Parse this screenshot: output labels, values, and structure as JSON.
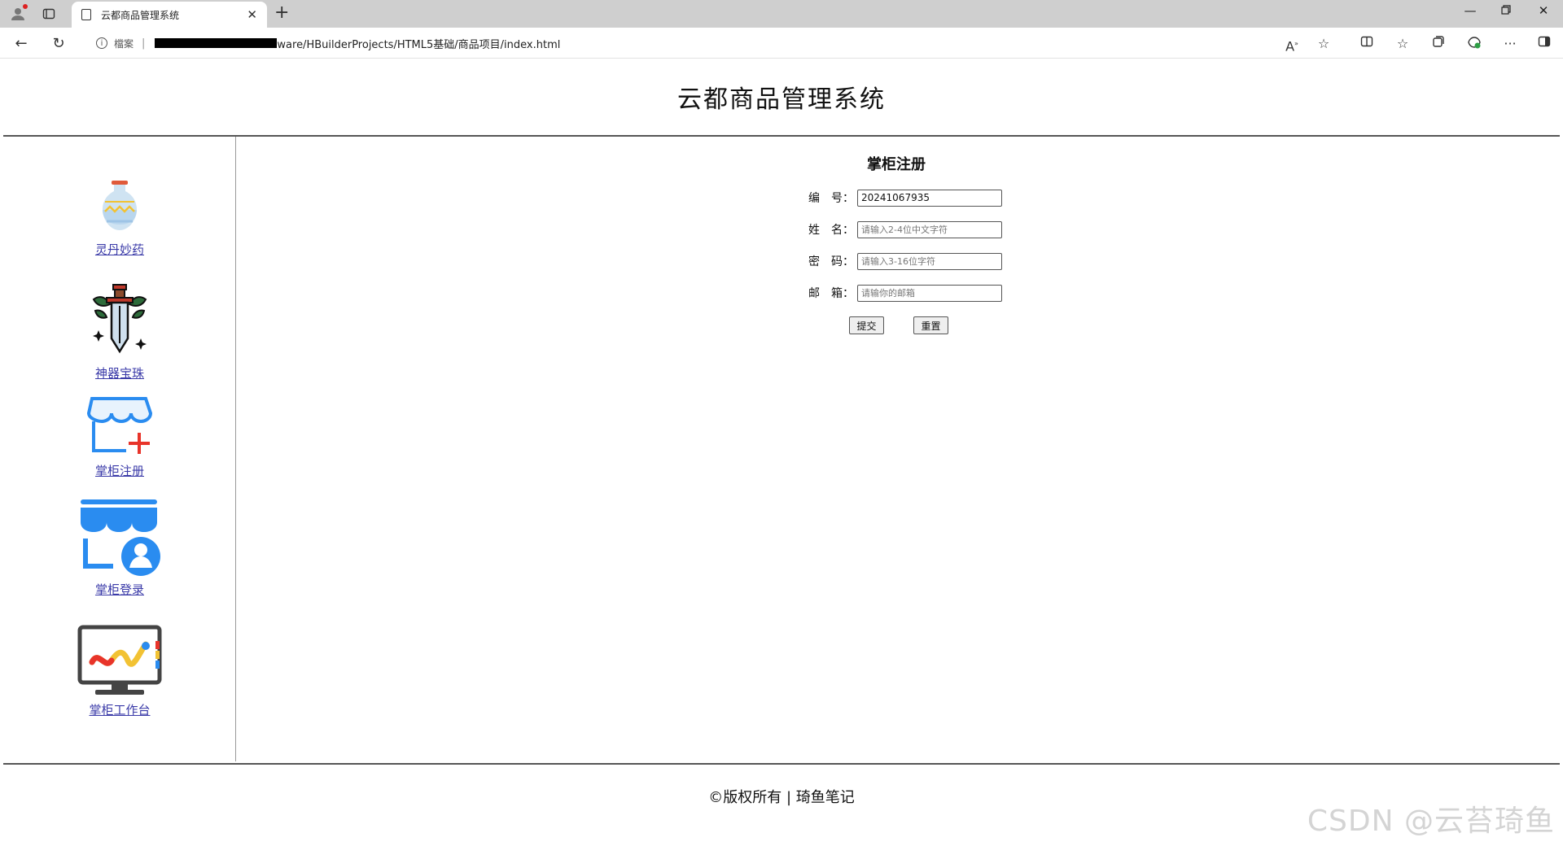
{
  "browser": {
    "tab_title": "云都商品管理系统",
    "address": {
      "label": "檔案",
      "url_visible": "ware/HBuilderProjects/HTML5基础/商品项目/index.html"
    }
  },
  "header": {
    "title": "云都商品管理系统"
  },
  "sidebar": {
    "items": [
      {
        "label": "灵丹妙药",
        "icon": "potion-vase-icon"
      },
      {
        "label": "神器宝珠",
        "icon": "sword-icon"
      },
      {
        "label": "掌柜注册",
        "icon": "shop-add-icon"
      },
      {
        "label": "掌柜登录",
        "icon": "shop-user-icon"
      },
      {
        "label": "掌柜工作台",
        "icon": "dashboard-monitor-icon"
      }
    ]
  },
  "form": {
    "title": "掌柜注册",
    "fields": [
      {
        "label": "编　号：",
        "value": "20241067935",
        "placeholder": ""
      },
      {
        "label": "姓　名：",
        "value": "",
        "placeholder": "请输入2-4位中文字符"
      },
      {
        "label": "密　码：",
        "value": "",
        "placeholder": "请输入3-16位字符"
      },
      {
        "label": "邮　箱：",
        "value": "",
        "placeholder": "请输你的邮箱"
      }
    ],
    "submit_label": "提交",
    "reset_label": "重置"
  },
  "footer": {
    "copyright": "©版权所有 | 琦鱼笔记",
    "watermark": "CSDN @云苔琦鱼"
  },
  "colors": {
    "link": "#3a3aa8",
    "icon_blue": "#2a8cf0",
    "icon_red": "#e8342a"
  }
}
